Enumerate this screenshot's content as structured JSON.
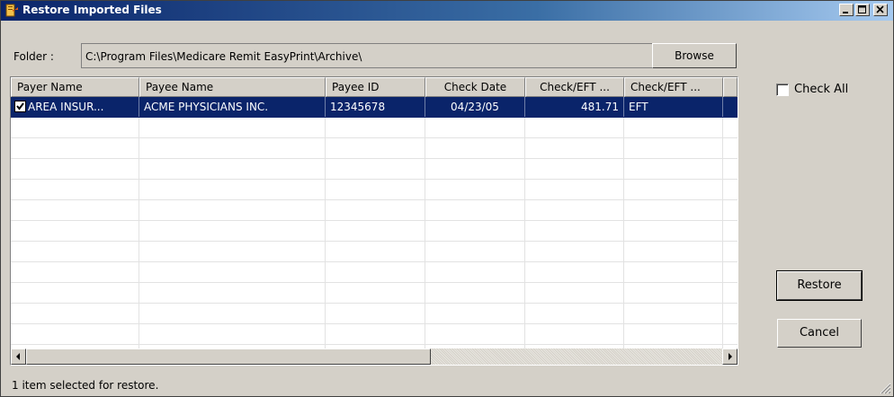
{
  "window": {
    "title": "Restore Imported Files"
  },
  "folder": {
    "label": "Folder :",
    "path": "C:\\Program Files\\Medicare Remit EasyPrint\\Archive\\",
    "browse_label": "Browse"
  },
  "table": {
    "columns": [
      "Payer Name",
      "Payee Name",
      "Payee ID",
      "Check Date",
      "Check/EFT ...",
      "Check/EFT ..."
    ],
    "rows": [
      {
        "checked": true,
        "selected": true,
        "payer_name": "AREA INSUR...",
        "payee_name": "ACME PHYSICIANS INC.",
        "payee_id": "12345678",
        "check_date": "04/23/05",
        "amount": "481.71",
        "check_eft": "EFT"
      }
    ]
  },
  "check_all": {
    "label": "Check All",
    "checked": false
  },
  "buttons": {
    "restore": "Restore",
    "cancel": "Cancel"
  },
  "status": {
    "text": "1 item selected for restore."
  },
  "colors": {
    "selection": "#0a246a",
    "face": "#d4d0c8",
    "title_start": "#0a246a",
    "title_end": "#a6caf0"
  }
}
